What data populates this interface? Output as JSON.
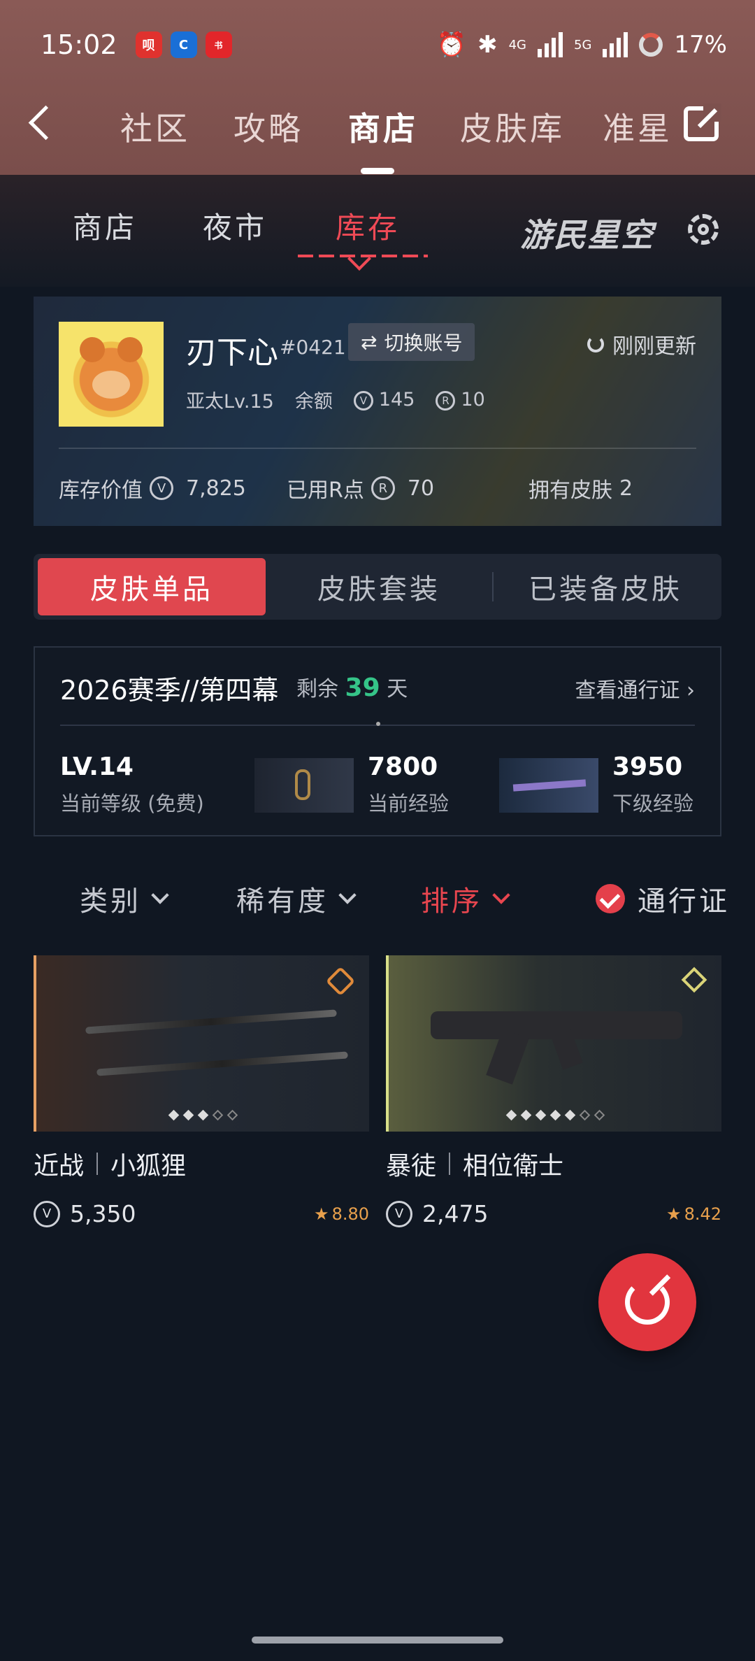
{
  "status": {
    "time": "15:02",
    "network1": "4G",
    "network2": "5G",
    "battery": "17%"
  },
  "nav": {
    "tabs": [
      {
        "label": "社区"
      },
      {
        "label": "攻略"
      },
      {
        "label": "商店",
        "active": true
      },
      {
        "label": "皮肤库"
      },
      {
        "label": "准星"
      }
    ]
  },
  "subtabs": [
    {
      "label": "商店"
    },
    {
      "label": "夜市"
    },
    {
      "label": "库存",
      "active": true
    }
  ],
  "brand": "游民星空",
  "profile": {
    "name": "刃下心",
    "tag": "#0421",
    "switch_label": "切换账号",
    "refresh_label": "刚刚更新",
    "region_level": "亚太Lv.15",
    "balance_label": "余额",
    "vp": "145",
    "rp": "10",
    "inventory_label": "库存价值",
    "inventory_value": "7,825",
    "rp_used_label": "已用R点",
    "rp_used_value": "70",
    "skins_owned_label": "拥有皮肤",
    "skins_owned_value": "2"
  },
  "segments": [
    {
      "label": "皮肤单品",
      "active": true
    },
    {
      "label": "皮肤套装"
    },
    {
      "label": "已装备皮肤"
    }
  ],
  "season": {
    "title": "2026赛季//第四幕",
    "remain_prefix": "剩余",
    "remain_days": "39",
    "remain_suffix": "天",
    "pass_label": "查看通行证",
    "level": "LV.14",
    "level_sub": "当前等级 (免费)",
    "xp_current": "7800",
    "xp_current_label": "当前经验",
    "xp_next": "3950",
    "xp_next_label": "下级经验"
  },
  "filters": [
    {
      "label": "类别"
    },
    {
      "label": "稀有度"
    },
    {
      "label": "排序",
      "active": true
    }
  ],
  "pass_filter_label": "通行证",
  "items": [
    {
      "category": "近战",
      "name": "小狐狸",
      "price": "5,350",
      "score": "8.80",
      "rarity_color": "#e08a3a",
      "levels_filled": 3,
      "levels_total": 5
    },
    {
      "category": "暴徒",
      "name": "相位衛士",
      "price": "2,475",
      "score": "8.42",
      "rarity_color": "#dad478",
      "levels_filled": 5,
      "levels_total": 7
    }
  ]
}
